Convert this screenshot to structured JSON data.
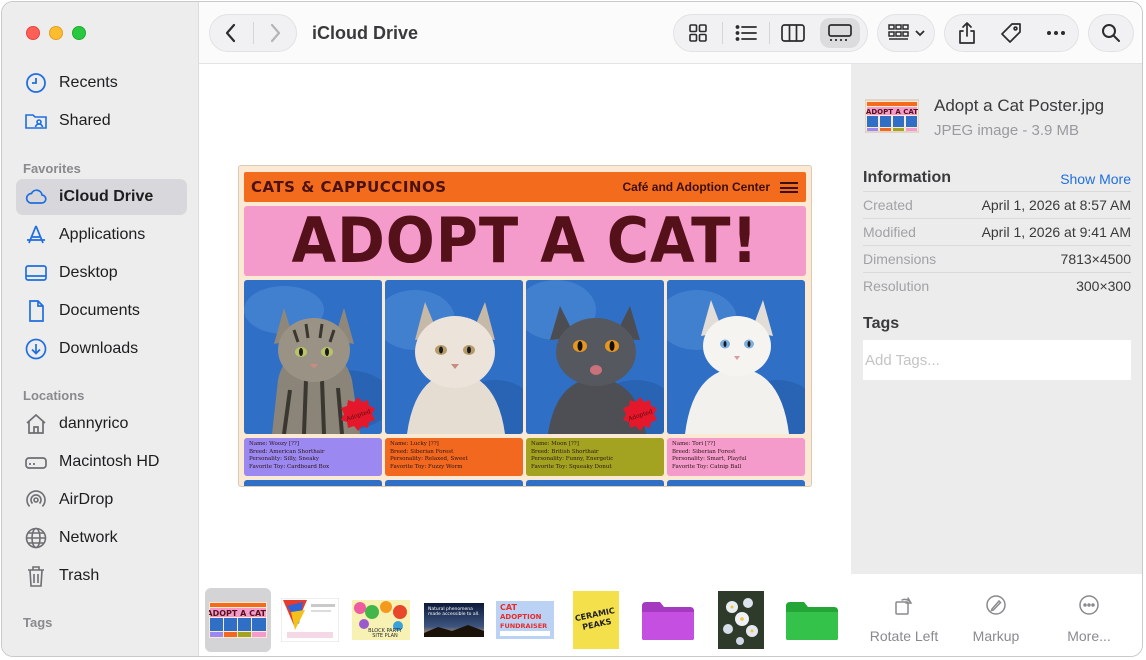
{
  "window": {
    "title": "iCloud Drive"
  },
  "sidebar": {
    "top_items": [
      {
        "label": "Recents",
        "icon": "clock-icon"
      },
      {
        "label": "Shared",
        "icon": "shared-folder-icon"
      }
    ],
    "favorites_header": "Favorites",
    "favorites": [
      {
        "label": "iCloud Drive",
        "icon": "cloud-icon",
        "selected": true
      },
      {
        "label": "Applications",
        "icon": "applications-icon"
      },
      {
        "label": "Desktop",
        "icon": "desktop-icon"
      },
      {
        "label": "Documents",
        "icon": "document-icon"
      },
      {
        "label": "Downloads",
        "icon": "download-icon"
      }
    ],
    "locations_header": "Locations",
    "locations": [
      {
        "label": "dannyrico",
        "icon": "home-icon"
      },
      {
        "label": "Macintosh HD",
        "icon": "disk-icon"
      },
      {
        "label": "AirDrop",
        "icon": "airdrop-icon"
      },
      {
        "label": "Network",
        "icon": "network-icon"
      },
      {
        "label": "Trash",
        "icon": "trash-icon"
      }
    ],
    "tags_header": "Tags"
  },
  "toolbar": {
    "view_modes": [
      "icon-view",
      "list-view",
      "column-view",
      "gallery-view"
    ],
    "selected_view": "gallery-view"
  },
  "preview": {
    "brand": "CATS & CAPPUCCINOS",
    "subtitle": "Café and Adoption Center",
    "headline": "ADOPT A CAT!",
    "badge_text": "Adopted",
    "cats": [
      {
        "name": "Name: Woozy [??]",
        "breed": "Breed: American Shorthair",
        "personality": "Personality: Silly, Sneaky",
        "toy": "Favorite Toy: Cardboard Box",
        "color": "#9b88f0",
        "adopted": true
      },
      {
        "name": "Name: Lucky [??]",
        "breed": "Breed: Siberian Forest",
        "personality": "Personality: Relaxed, Sweet",
        "toy": "Favorite Toy: Fuzzy Worm",
        "color": "#f2681f",
        "adopted": false
      },
      {
        "name": "Name: Moon [??]",
        "breed": "Breed: British Shorthair",
        "personality": "Personality: Funny, Energetic",
        "toy": "Favorite Toy: Squeaky Donut",
        "color": "#a4a321",
        "adopted": true
      },
      {
        "name": "Name: Tori [??]",
        "breed": "Breed: Siberian Forest",
        "personality": "Personality: Smart, Playful",
        "toy": "Favorite Toy: Catnip Ball",
        "color": "#f59bcb",
        "adopted": false
      }
    ]
  },
  "inspector": {
    "file_name": "Adopt a Cat Poster.jpg",
    "file_type": "JPEG image - 3.9 MB",
    "info_title": "Information",
    "show_more": "Show More",
    "rows": [
      {
        "key": "Created",
        "value": "April 1, 2026 at 8:57 AM"
      },
      {
        "key": "Modified",
        "value": "April 1, 2026 at 9:41 AM"
      },
      {
        "key": "Dimensions",
        "value": "7813×4500"
      },
      {
        "key": "Resolution",
        "value": "300×300"
      }
    ],
    "tags_title": "Tags",
    "tags_placeholder": "Add Tags..."
  },
  "gallery_thumbs": [
    {
      "label": "ADOPT A CAT!",
      "selected": true
    },
    {
      "label": ""
    },
    {
      "label": "BLOCK PARTY SITE PLAN"
    },
    {
      "label": "Natural phenomena made accessible to all"
    },
    {
      "label": "CAT ADOPTION FUNDRAISER"
    },
    {
      "label": "CERAMIC PEAKS"
    },
    {
      "label": ""
    },
    {
      "label": ""
    },
    {
      "label": ""
    }
  ],
  "actions": [
    {
      "label": "Rotate Left",
      "icon": "rotate-left-icon"
    },
    {
      "label": "Markup",
      "icon": "markup-icon"
    },
    {
      "label": "More...",
      "icon": "more-icon"
    }
  ],
  "colors": {
    "accent": "#1f6fe0",
    "poster_orange": "#f36b1c",
    "poster_pink": "#f59bcb",
    "poster_maroon": "#55111a",
    "folder_purple": "#c44fe0",
    "folder_green": "#35c24a"
  }
}
